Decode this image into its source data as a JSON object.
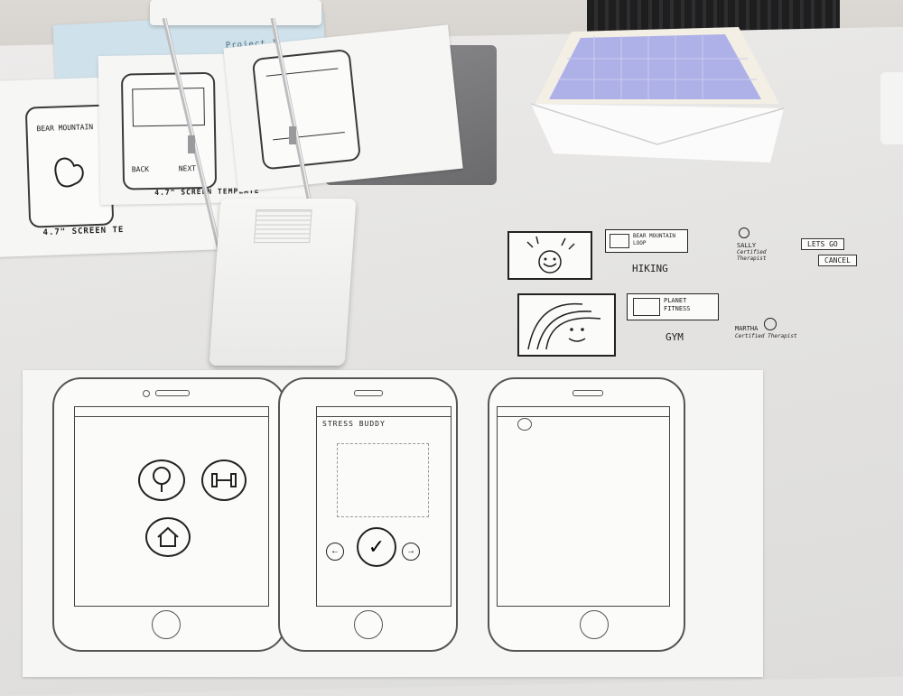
{
  "background_papers": {
    "header_fragment": "Project 1",
    "screen_template_label_left": "4.7\" SCREEN TE",
    "screen_template_label_right": "4.7\" SCREEN TEMPLATE",
    "sketch_texts": [
      "BEAR MOUNTAIN",
      "NEXT",
      "BACK"
    ]
  },
  "cutouts": {
    "cards": [
      {
        "title": "BEAR MOUNTAIN LOOP",
        "caption": "HIKING"
      },
      {
        "title": "PLANET FITNESS",
        "caption": "GYM"
      }
    ],
    "therapists": [
      {
        "name": "SALLY",
        "role": "Certified Therapist"
      },
      {
        "name": "MARTHA",
        "role": "Certified Therapist"
      }
    ],
    "buttons": {
      "confirm": "LETS GO",
      "cancel": "CANCEL"
    }
  },
  "phones": [
    {
      "title": "",
      "icons": [
        "tree-icon",
        "dumbbell-icon",
        "home-icon"
      ]
    },
    {
      "title": "STRESS BUDDY",
      "icons": [
        "arrow-left-icon",
        "checkmark-icon",
        "arrow-right-icon"
      ]
    },
    {
      "title": "",
      "icons": [
        "avatar-placeholder-icon"
      ]
    }
  ],
  "colors": {
    "table": "#e3e2e0",
    "paper": "#f6f6f4",
    "ink": "#1d1d1d",
    "envelope_liner": "#aeb0e8",
    "lamp": "#c9c9cb"
  }
}
